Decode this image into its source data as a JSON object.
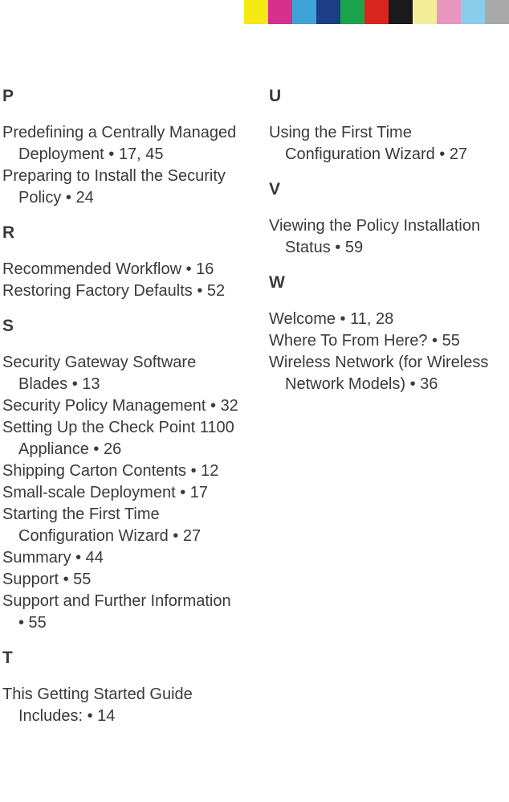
{
  "colorbar": [
    "#f6ea14",
    "#d62f8c",
    "#3ea3d7",
    "#1b3e86",
    "#1ba54a",
    "#d9261e",
    "#1a1a1a",
    "#f4ee9a",
    "#e797bf",
    "#89cceb",
    "#a9a9a9"
  ],
  "left": {
    "sections": [
      {
        "letter": "P",
        "entries": [
          "Predefining a Centrally Managed Deployment • 17, 45",
          "Preparing to Install the Security Policy • 24"
        ]
      },
      {
        "letter": "R",
        "entries": [
          "Recommended Workflow • 16",
          "Restoring Factory Defaults • 52"
        ]
      },
      {
        "letter": "S",
        "entries": [
          "Security Gateway Software Blades • 13",
          "Security Policy Management • 32",
          "Setting Up the Check Point 1100 Appliance • 26",
          "Shipping Carton Contents • 12",
          "Small-scale Deployment • 17",
          "Starting the First Time Configuration Wizard • 27",
          "Summary • 44",
          "Support • 55",
          "Support and Further Information • 55"
        ]
      },
      {
        "letter": "T",
        "entries": [
          "This Getting Started Guide Includes: • 14"
        ]
      }
    ]
  },
  "right": {
    "sections": [
      {
        "letter": "U",
        "entries": [
          "Using the First Time Configuration Wizard • 27"
        ]
      },
      {
        "letter": "V",
        "entries": [
          "Viewing the Policy Installation Status • 59"
        ]
      },
      {
        "letter": "W",
        "entries": [
          "Welcome • 11, 28",
          "Where To From Here? • 55",
          "Wireless Network (for Wireless Network Models) • 36"
        ]
      }
    ]
  }
}
